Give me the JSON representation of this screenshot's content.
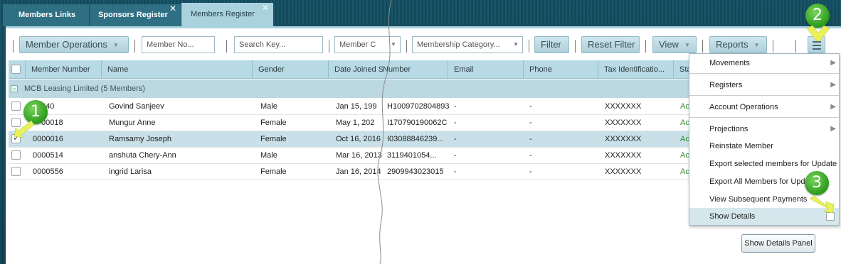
{
  "tabs": [
    {
      "label": "Members Links",
      "closable": false
    },
    {
      "label": "Sponsors Register",
      "closable": true
    },
    {
      "label": "Members Register",
      "closable": true,
      "active": true
    }
  ],
  "toolbar": {
    "member_operations": "Member Operations",
    "member_no_placeholder": "Member No...",
    "search_key_placeholder": "Search Key...",
    "member_c": "Member C",
    "membership_category": "Membership Category...",
    "filter": "Filter",
    "reset_filter": "Reset Filter",
    "view": "View",
    "reports": "Reports"
  },
  "grid": {
    "columns": [
      "Member Number",
      "Name",
      "Gender",
      "Date Joined Scl",
      "Number",
      "Email",
      "Phone",
      "Tax Identificatio...",
      "Sta"
    ],
    "group_label": "MCB Leasing Limited (5 Members)",
    "rows": [
      {
        "number": "340",
        "name": "Govind Sanjeev",
        "gender": "Male",
        "date": "Jan 15, 199",
        "id_number": "H1009702804893",
        "email": "-",
        "phone": "-",
        "tax": "XXXXXXX",
        "status": "Ac",
        "selected": false
      },
      {
        "number": "00018",
        "name": "Mungur Anne",
        "gender": "Female",
        "date": "May 1, 202",
        "id_number": "I170790190062C",
        "email": "-",
        "phone": "-",
        "tax": "XXXXXXX",
        "status": "Ac",
        "selected": false
      },
      {
        "number": "0000016",
        "name": "Ramsamy Joseph",
        "gender": "Female",
        "date": "Oct 16, 2016",
        "id_number": "I03088846239...",
        "email": "-",
        "phone": "-",
        "tax": "XXXXXXX",
        "status": "Ac",
        "selected": true
      },
      {
        "number": "0000514",
        "name": "anshuta Chery-Ann",
        "gender": "Male",
        "date": "Mar 16, 2013",
        "id_number": "3119401054...",
        "email": "-",
        "phone": "-",
        "tax": "XXXXXXX",
        "status": "Ac",
        "selected": false
      },
      {
        "number": "0000556",
        "name": "ingrid Larisa",
        "gender": "Female",
        "date": "Jan 16, 2014",
        "id_number": "2909943023015",
        "email": "-",
        "phone": "-",
        "tax": "XXXXXXX",
        "status": "Ac",
        "selected": false
      }
    ]
  },
  "menu": {
    "movements": "Movements",
    "registers": "Registers",
    "account_operations": "Account Operations",
    "projections": "Projections",
    "reinstate_member": "Reinstate Member",
    "export_selected": "Export selected members for Update",
    "export_all": "Export All Members for Upd",
    "view_subsequent": "View Subsequent Payments",
    "show_details": "Show Details"
  },
  "show_details_panel": "Show Details Panel",
  "annotations": {
    "one": "1",
    "two": "2",
    "three": "3"
  },
  "colors": {
    "accent": "#a9d2de",
    "header": "#b8dae4",
    "status_green": "#2f8a2f",
    "badge": "#2a9b1b",
    "arrow": "#e8f05a"
  }
}
